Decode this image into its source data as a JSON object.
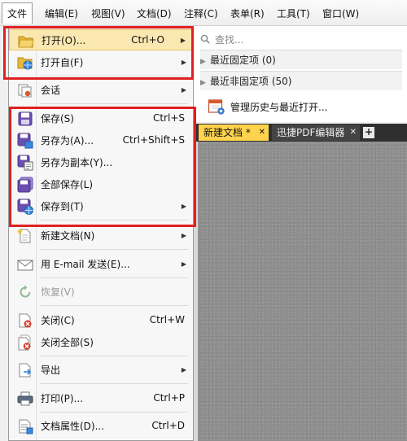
{
  "menubar": {
    "items": [
      {
        "label": "文件",
        "active": true
      },
      {
        "label": "编辑(E)"
      },
      {
        "label": "视图(V)"
      },
      {
        "label": "文档(D)"
      },
      {
        "label": "注释(C)"
      },
      {
        "label": "表单(R)"
      },
      {
        "label": "工具(T)"
      },
      {
        "label": "窗口(W)"
      }
    ]
  },
  "file_menu": {
    "items": [
      {
        "label": "打开(O)...",
        "shortcut": "Ctrl+O",
        "submenu": true,
        "icon": "folder-open-icon"
      },
      {
        "label": "打开自(F)",
        "shortcut": "",
        "submenu": true,
        "icon": "folder-globe-icon"
      },
      {
        "label": "会话",
        "shortcut": "",
        "submenu": true,
        "icon": "session-icon"
      },
      {
        "label": "保存(S)",
        "shortcut": "Ctrl+S",
        "submenu": false,
        "icon": "save-icon"
      },
      {
        "label": "另存为(A)...",
        "shortcut": "Ctrl+Shift+S",
        "submenu": false,
        "icon": "save-as-icon"
      },
      {
        "label": "另存为副本(Y)...",
        "shortcut": "",
        "submenu": false,
        "icon": "save-copy-icon"
      },
      {
        "label": "全部保存(L)",
        "shortcut": "",
        "submenu": false,
        "icon": "save-all-icon"
      },
      {
        "label": "保存到(T)",
        "shortcut": "",
        "submenu": true,
        "icon": "save-to-icon"
      },
      {
        "label": "新建文档(N)",
        "shortcut": "",
        "submenu": true,
        "icon": "new-document-icon"
      },
      {
        "label": "用 E-mail 发送(E)...",
        "shortcut": "",
        "submenu": true,
        "icon": "email-icon"
      },
      {
        "label": "恢复(V)",
        "shortcut": "",
        "submenu": false,
        "icon": "restore-icon",
        "disabled": true
      },
      {
        "label": "关闭(C)",
        "shortcut": "Ctrl+W",
        "submenu": false,
        "icon": "close-document-icon"
      },
      {
        "label": "关闭全部(S)",
        "shortcut": "",
        "submenu": false,
        "icon": "close-all-icon"
      },
      {
        "label": "导出",
        "shortcut": "",
        "submenu": true,
        "icon": "export-icon"
      },
      {
        "label": "打印(P)...",
        "shortcut": "Ctrl+P",
        "submenu": false,
        "icon": "printer-icon"
      },
      {
        "label": "文档属性(D)...",
        "shortcut": "Ctrl+D",
        "submenu": false,
        "icon": "document-properties-icon"
      }
    ]
  },
  "recent_panel": {
    "search_placeholder": "查找...",
    "pinned_label": "最近固定项 (0)",
    "unpinned_label": "最近非固定项 (50)",
    "manage_label": "管理历史与最近打开..."
  },
  "doc_tabs": {
    "active_label": "新建文档 *",
    "inactive_label": "迅捷PDF编辑器",
    "add_label": "+"
  },
  "colors": {
    "highlight": "#fbe7b0",
    "annotation_red": "#e02020",
    "active_tab": "#ffd34d",
    "tab_bar": "#2f2f2f"
  }
}
